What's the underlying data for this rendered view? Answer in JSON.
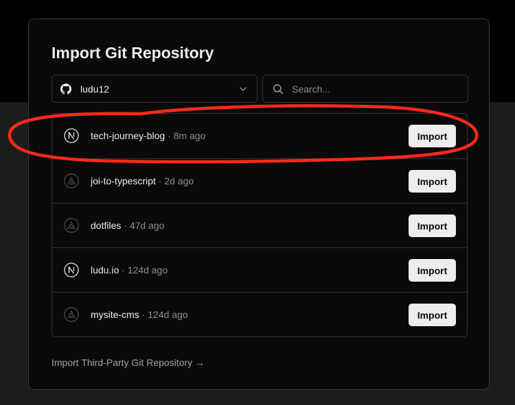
{
  "dialog": {
    "title": "Import Git Repository"
  },
  "account_select": {
    "value": "ludu12",
    "icon": "github-icon"
  },
  "search": {
    "placeholder": "Search...",
    "value": ""
  },
  "repos": [
    {
      "name": "tech-journey-blog",
      "separator": "·",
      "time": "8m ago",
      "icon": "nextjs-icon",
      "button": "Import"
    },
    {
      "name": "joi-to-typescript",
      "separator": "·",
      "time": "2d ago",
      "icon": "triangle-icon",
      "button": "Import"
    },
    {
      "name": "dotfiles",
      "separator": "·",
      "time": "47d ago",
      "icon": "triangle-icon",
      "button": "Import"
    },
    {
      "name": "ludu.io",
      "separator": "·",
      "time": "124d ago",
      "icon": "nextjs-icon",
      "button": "Import"
    },
    {
      "name": "mysite-cms",
      "separator": "·",
      "time": "124d ago",
      "icon": "triangle-icon",
      "button": "Import"
    }
  ],
  "footer": {
    "third_party_link": "Import Third-Party Git Repository →"
  },
  "colors": {
    "background_top": "#000000",
    "background_bottom": "#1c1c1c",
    "card": "#0a0a0a",
    "border": "#333333",
    "button": "#ededed",
    "annotation": "#ff2a1a"
  }
}
